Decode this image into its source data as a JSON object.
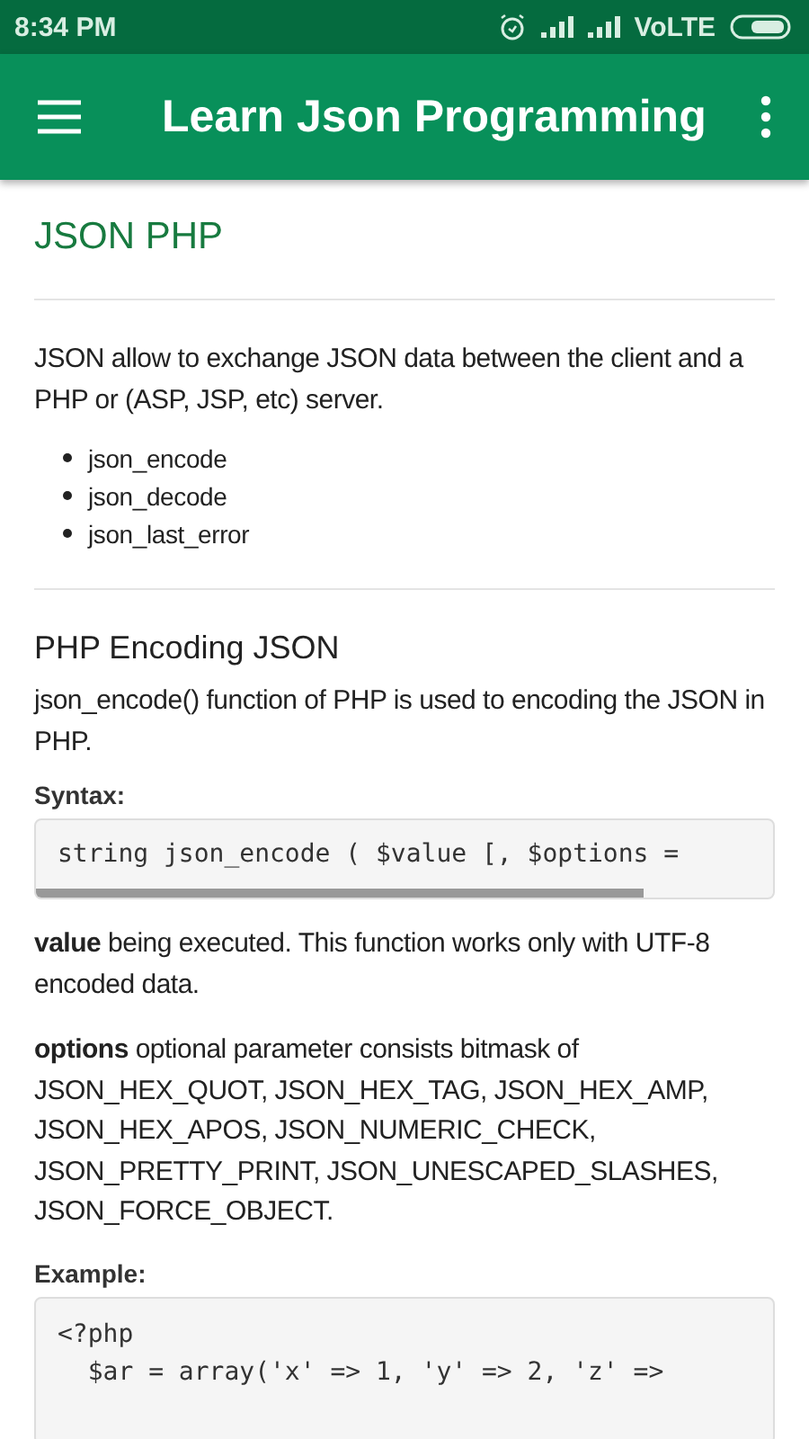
{
  "status_bar": {
    "time": "8:34 PM",
    "network": "VoLTE"
  },
  "app_bar": {
    "title": "Learn Json Programming"
  },
  "page_title": "JSON PHP",
  "intro": "JSON allow to exchange JSON data between the client and a PHP or (ASP, JSP, etc) server.",
  "functions": [
    "json_encode",
    "json_decode",
    "json_last_error"
  ],
  "section": {
    "heading": "PHP Encoding JSON",
    "description": "json_encode() function of PHP is used to encoding the JSON in PHP.",
    "syntax_label": "Syntax:",
    "syntax_code": "string json_encode ( $value [, $options =",
    "notes": [
      "**value** being executed. This function works only with UTF-8 encoded data.",
      "**options** optional parameter consists bitmask of JSON_HEX_QUOT, JSON_HEX_TAG, JSON_HEX_AMP, JSON_HEX_APOS, JSON_NUMERIC_CHECK, JSON_PRETTY_PRINT, JSON_UNESCAPED_SLASHES, JSON_FORCE_OBJECT."
    ],
    "example_label": "Example:",
    "example_code": [
      "<?php",
      "  $ar = array('x' => 1, 'y' => 2, 'z' =>"
    ]
  }
}
